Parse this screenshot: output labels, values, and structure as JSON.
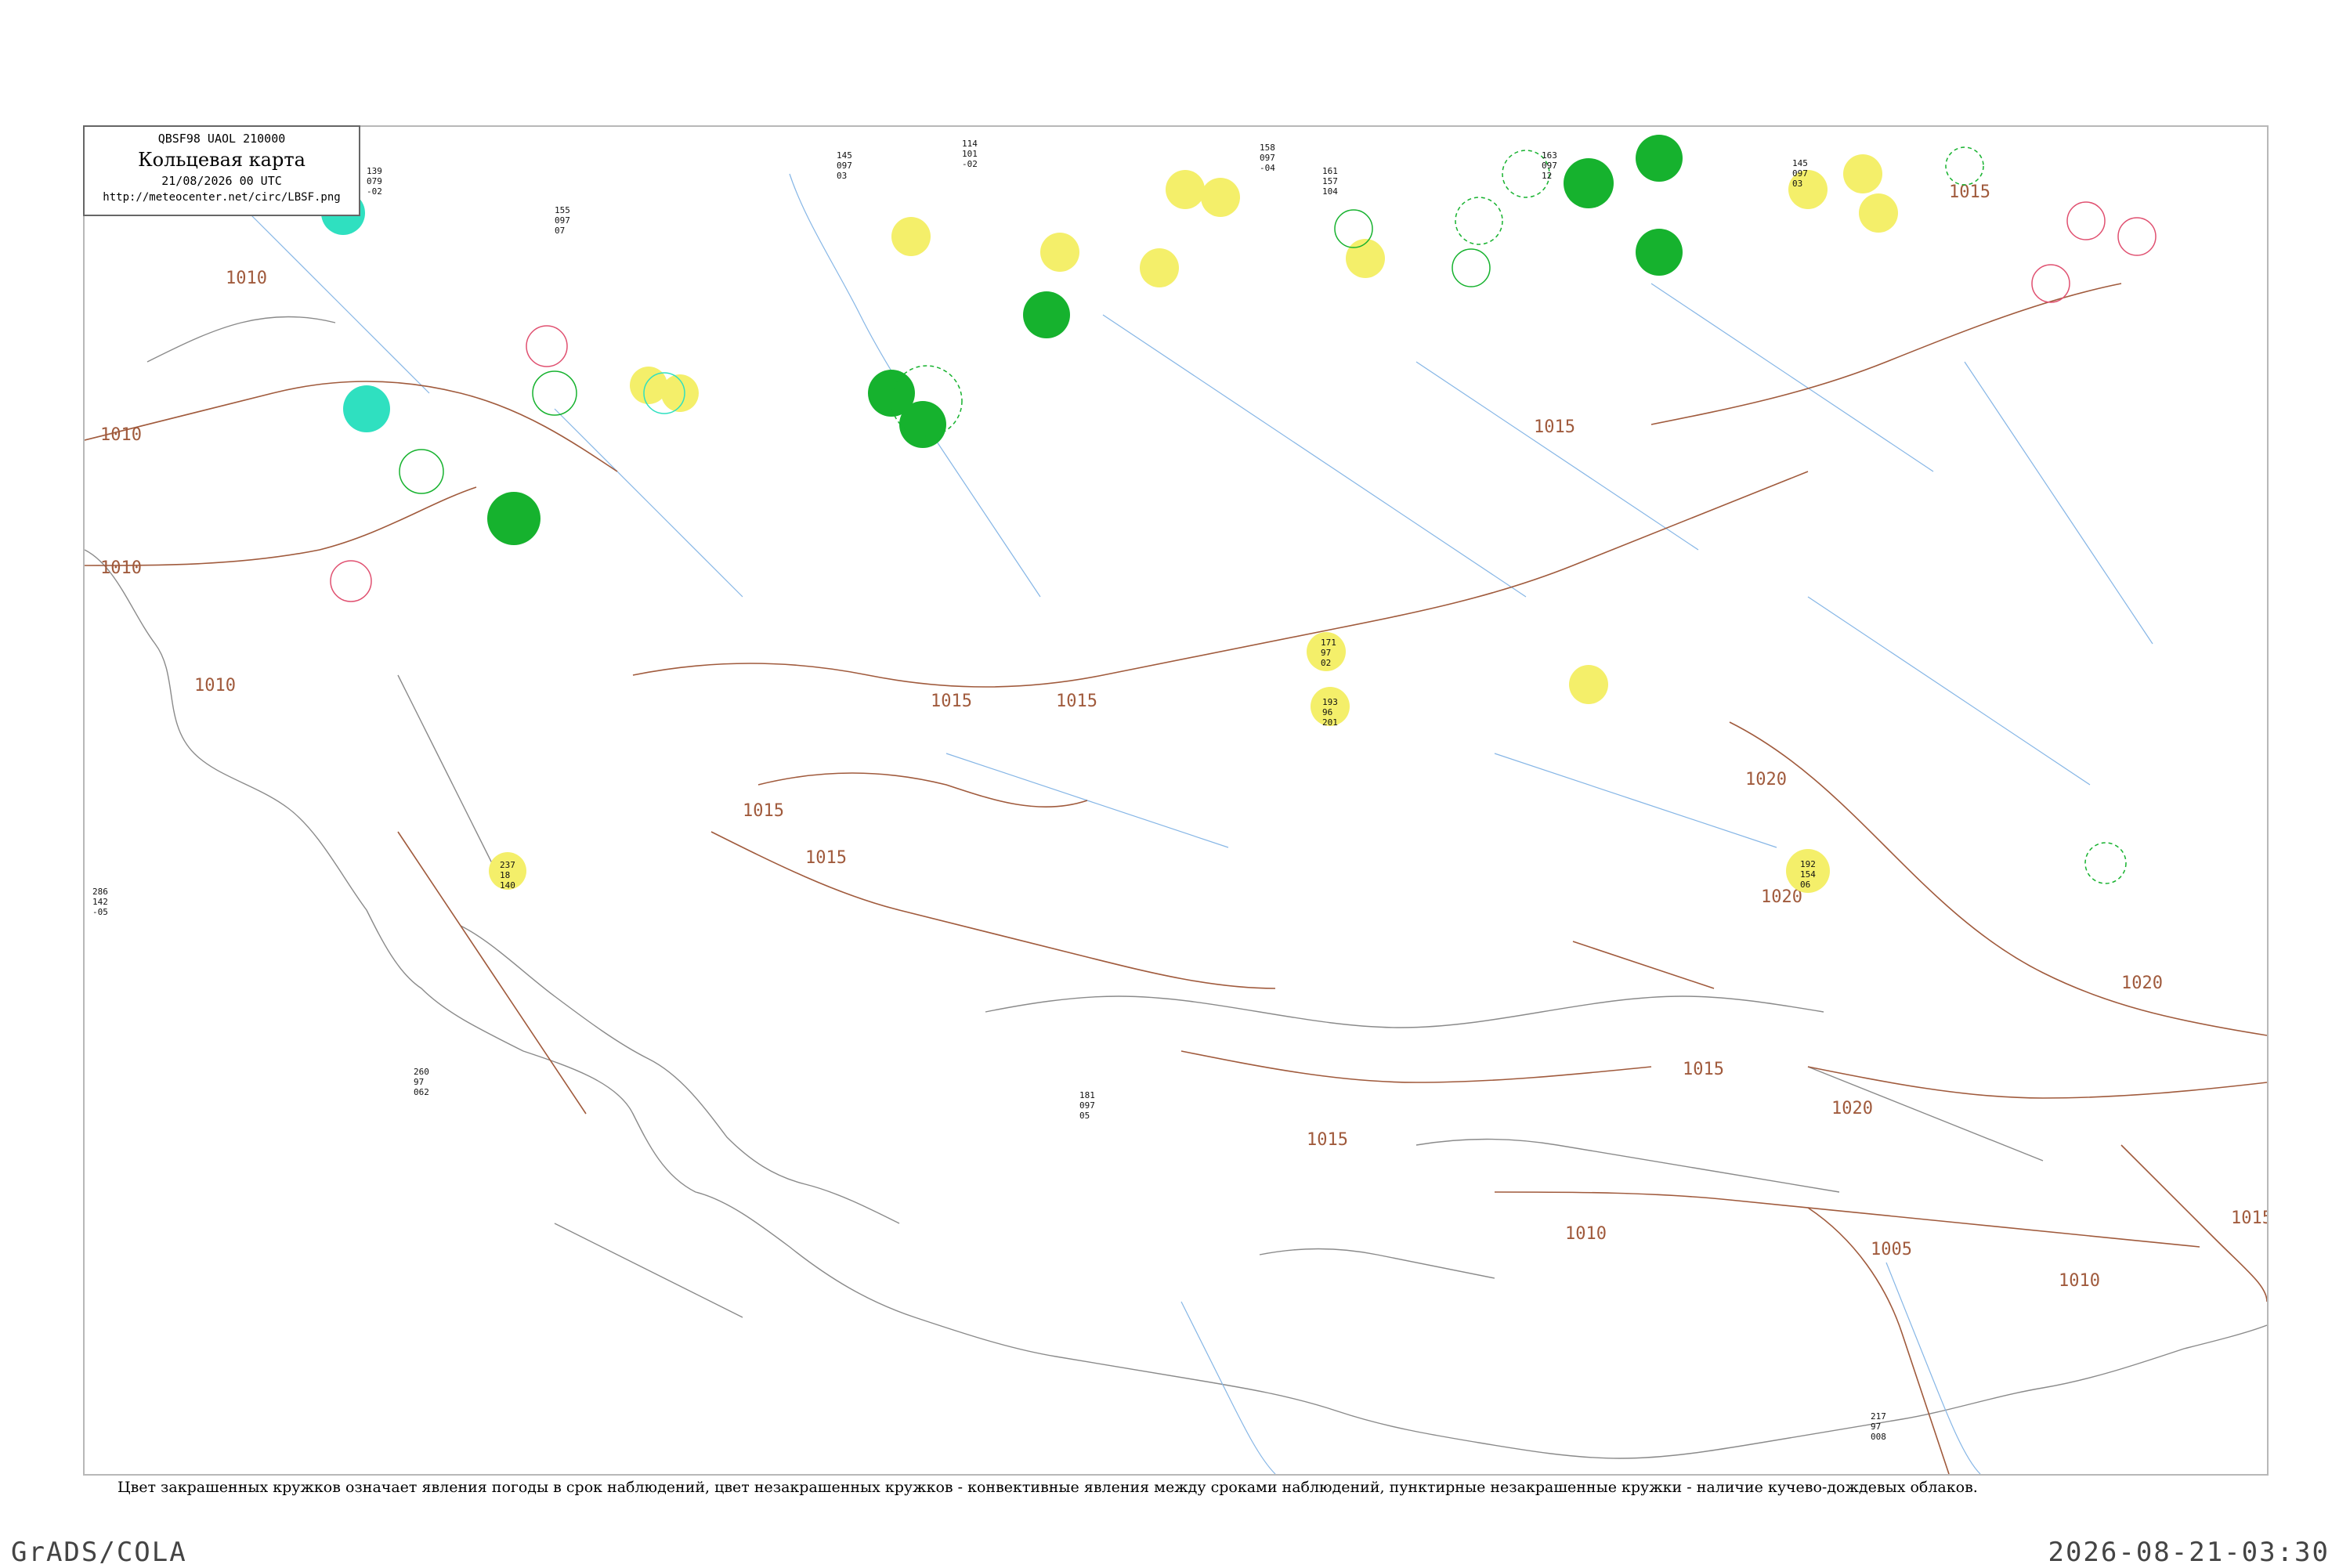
{
  "header": {
    "code": "QBSF98  UAOL  210000",
    "title": "Кольцевая карта",
    "date": "21/08/2026 00 UTC",
    "url": "http://meteocenter.net/circ/LBSF.png"
  },
  "legend": "Цвет закрашенных кружков означает явления погоды в срок наблюдений, цвет незакрашенных кружков - конвективные явления между сроками наблюдений, пунктирные незакрашенные кружки - наличие кучево-дождевых облаков.",
  "footer": {
    "left": "GrADS/COLA",
    "right": "2026-08-21-03:30"
  },
  "colors": {
    "coast": "#8a8a8a",
    "rivers": "#86b6e6",
    "isobars": "#a05a3c",
    "rain": "#16b22e",
    "fog_haze": "#f4ef6a",
    "shower": "#2fe0c0",
    "thunder": "#e05070"
  },
  "isobars": [
    {
      "label": "1010"
    },
    {
      "label": "1010"
    },
    {
      "label": "1010"
    },
    {
      "label": "1010"
    },
    {
      "label": "1015"
    },
    {
      "label": "1015"
    },
    {
      "label": "1015"
    },
    {
      "label": "1015"
    },
    {
      "label": "1015"
    },
    {
      "label": "1015"
    },
    {
      "label": "1020"
    },
    {
      "label": "1020"
    },
    {
      "label": "1020"
    },
    {
      "label": "1015"
    },
    {
      "label": "1010"
    },
    {
      "label": "1005"
    },
    {
      "label": "1010"
    },
    {
      "label": "1015"
    },
    {
      "label": "1020"
    },
    {
      "label": "1015"
    }
  ],
  "stations": [
    {
      "p": "139",
      "t": "079",
      "d": "-02"
    },
    {
      "p": "155",
      "t": "097",
      "d": "07"
    },
    {
      "p": "145",
      "t": "097",
      "d": "03"
    },
    {
      "p": "114",
      "t": "101",
      "d": "-02"
    },
    {
      "p": "158",
      "t": "097",
      "d": "-04"
    },
    {
      "p": "161",
      "t": "157",
      "d": "104"
    },
    {
      "p": "163",
      "t": "097",
      "d": "12"
    },
    {
      "p": "145",
      "t": "097",
      "d": "03"
    },
    {
      "p": "181",
      "t": "097",
      "d": "05"
    },
    {
      "p": "171",
      "t": "97",
      "d": "02"
    },
    {
      "p": "193",
      "t": "96",
      "d": "201"
    },
    {
      "p": "192",
      "t": "154",
      "d": "06"
    },
    {
      "p": "237",
      "t": "18",
      "d": "140"
    },
    {
      "p": "217",
      "t": "97",
      "d": "008"
    },
    {
      "p": "260",
      "t": "97",
      "d": "062"
    },
    {
      "p": "286",
      "t": "142",
      "d": "-05"
    }
  ]
}
